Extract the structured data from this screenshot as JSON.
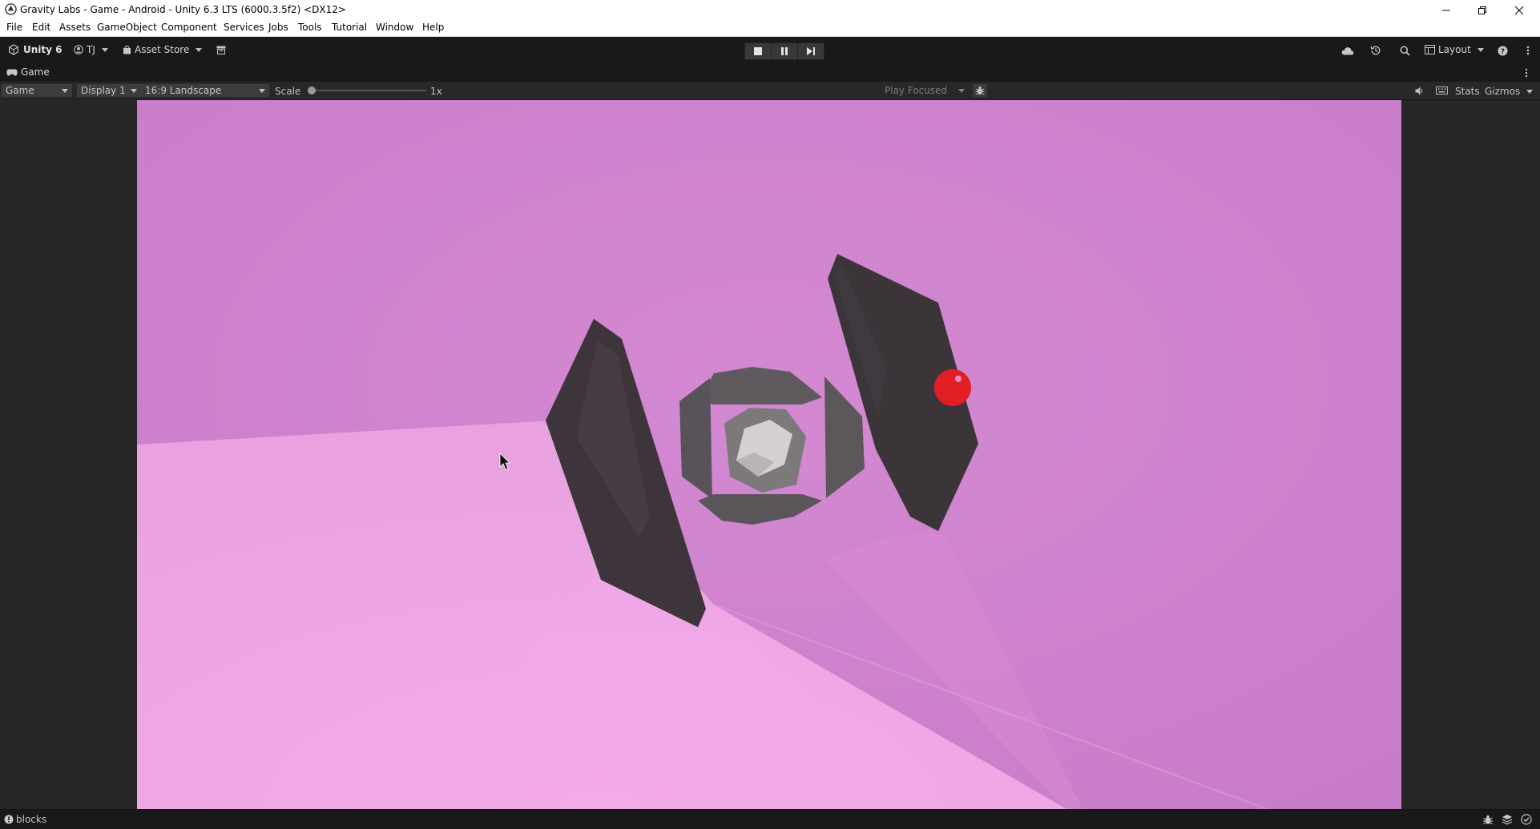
{
  "window": {
    "title": "Gravity Labs - Game - Android - Unity 6.3 LTS (6000.3.5f2) <DX12>"
  },
  "menu": [
    "File",
    "Edit",
    "Assets",
    "GameObject",
    "Component",
    "Services",
    "Jobs",
    "Tools",
    "Tutorial",
    "Window",
    "Help"
  ],
  "toolbar": {
    "unity_label": "Unity 6",
    "account_label": "TJ",
    "asset_store_label": "Asset Store",
    "layout_label": "Layout"
  },
  "tab": {
    "label": "Game"
  },
  "game_controls": {
    "view_mode": "Game",
    "display": "Display 1",
    "aspect": "16:9 Landscape",
    "scale_label": "Scale",
    "scale_value": "1x",
    "scale_fraction": 0.0,
    "play_focus": "Play Focused",
    "stats_label": "Stats",
    "gizmos_label": "Gizmos"
  },
  "status": {
    "text": "blocks"
  },
  "colors": {
    "editor_bg": "#191919",
    "sky": "#cd7fcc",
    "floor": "#eea6e3",
    "ship_dark": "#3b353a",
    "ship_gray": "#5e5a5d",
    "ball_red": "#e01e24"
  }
}
